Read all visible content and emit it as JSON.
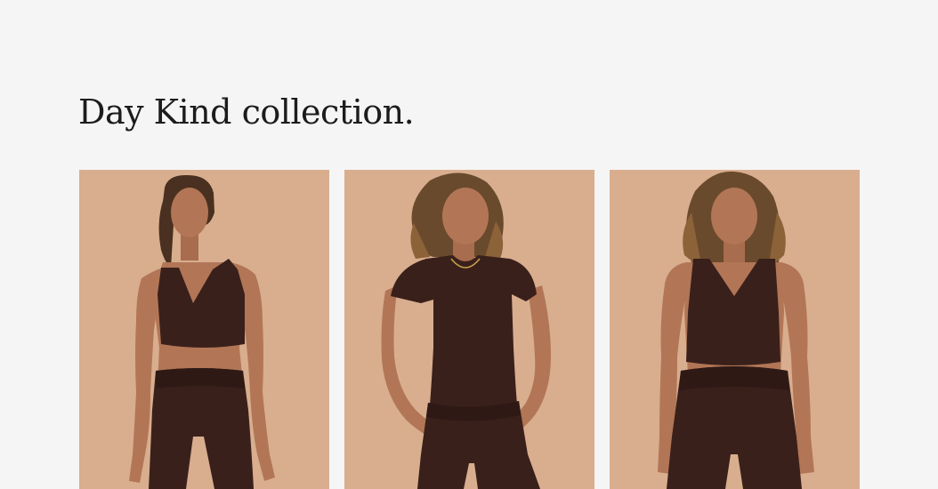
{
  "section": {
    "title": "Day Kind collection."
  },
  "colors": {
    "page_background": "#f5f5f5",
    "photo_backdrop": "#d8ae8f",
    "garment": "#3a201b",
    "skin": "#b27656",
    "hair": "#4a3020",
    "hair_highlight": "#8c6238"
  },
  "products": [
    {
      "image": "model-crop-top-leggings-photo"
    },
    {
      "image": "model-tee-shorts-photo"
    },
    {
      "image": "model-tank-shorts-photo"
    }
  ]
}
